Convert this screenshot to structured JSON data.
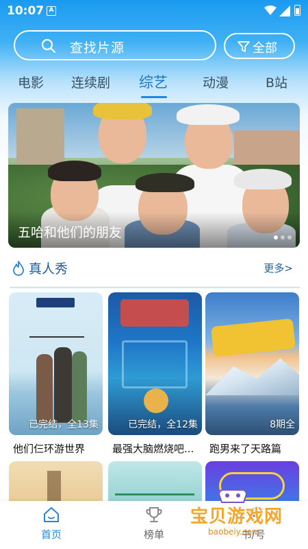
{
  "status_bar": {
    "time": "10:07",
    "notification_glyph": "A"
  },
  "search": {
    "placeholder": "查找片源",
    "filter_label": "全部"
  },
  "tabs": [
    {
      "label": "电影",
      "active": false
    },
    {
      "label": "连续剧",
      "active": false
    },
    {
      "label": "综艺",
      "active": true
    },
    {
      "label": "动漫",
      "active": false
    },
    {
      "label": "B站",
      "active": false
    }
  ],
  "banner": {
    "caption": "五哈和他们的朋友",
    "dots": 3
  },
  "section": {
    "title": "真人秀",
    "more": "更多>"
  },
  "cards": [
    {
      "title": "他们仨环游世界",
      "badge": "已完结，全13集"
    },
    {
      "title": "最强大脑燃烧吧...",
      "badge": "已完结，全12集"
    },
    {
      "title": "跑男来了天路篇",
      "badge": "8期全"
    }
  ],
  "nav": {
    "home": "首页",
    "rank": "榜单",
    "third": "书/号"
  },
  "watermark": {
    "text": "宝贝游戏网",
    "url": "baobeiy.com"
  },
  "colors": {
    "accent": "#1e88e5",
    "header_blue": "#1a9bf0",
    "section_text": "#1c5f9e"
  }
}
